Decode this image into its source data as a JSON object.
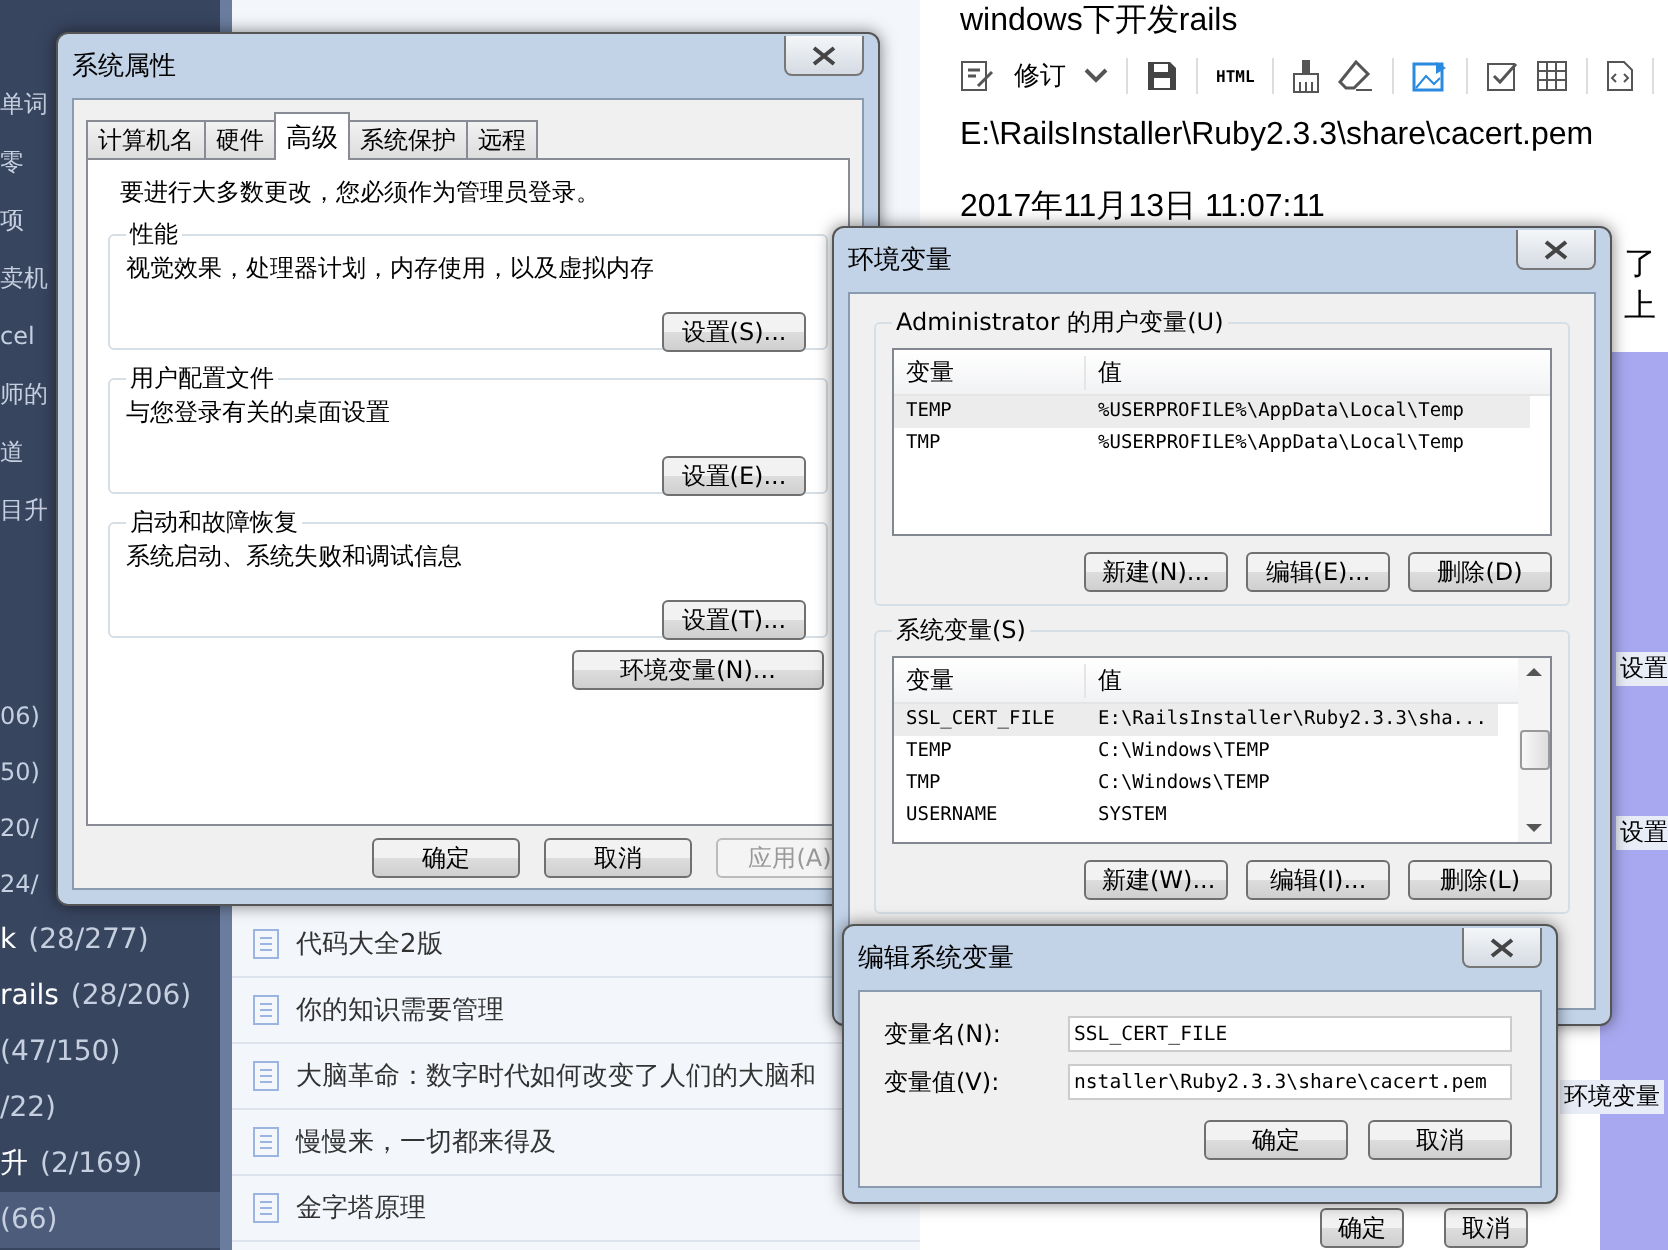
{
  "sidebar": {
    "top_items": [
      {
        "label": "单词"
      },
      {
        "label": "零"
      },
      {
        "label": "项"
      },
      {
        "label": "卖机"
      },
      {
        "label": "cel"
      },
      {
        "label": "师的"
      },
      {
        "label": "道"
      },
      {
        "label": "目升"
      }
    ],
    "count_items": [
      {
        "count": "06)",
        "selected": false
      },
      {
        "count": "50)",
        "selected": false
      },
      {
        "count": "20/",
        "selected": false
      },
      {
        "count": "24/",
        "selected": false
      },
      {
        "label": "k",
        "count": "(28/277)",
        "selected": false
      },
      {
        "label": "rails",
        "count": "(28/206)",
        "selected": false
      },
      {
        "count": "(47/150)",
        "selected": false
      },
      {
        "count": "/22)",
        "selected": false
      },
      {
        "label": "升",
        "count": "(2/169)",
        "selected": false
      },
      {
        "count": "(66)",
        "selected": true
      }
    ]
  },
  "note_list": {
    "items": [
      {
        "title": "代码大全2版"
      },
      {
        "title": "你的知识需要管理"
      },
      {
        "title": "大脑革命：数字时代如何改变了人们的大脑和"
      },
      {
        "title": "慢慢来，一切都来得及"
      },
      {
        "title": "金字塔原理"
      }
    ]
  },
  "editor": {
    "title": "windows下开发rails",
    "toolbar": {
      "revise_label": "修订",
      "html_label": "HTML"
    },
    "lines": [
      "E:\\RailsInstaller\\Ruby2.3.3\\share\\cacert.pem",
      "2017年11月13日 11:07:11"
    ],
    "side_fragment": "了上"
  },
  "background_window": {
    "fragments": [
      "设置",
      "设置",
      "环境变量"
    ],
    "buttons": [
      "确定",
      "取消"
    ]
  },
  "system_properties": {
    "title": "系统属性",
    "tabs": [
      {
        "label": "计算机名",
        "selected": false
      },
      {
        "label": "硬件",
        "selected": false
      },
      {
        "label": "高级",
        "selected": true
      },
      {
        "label": "系统保护",
        "selected": false
      },
      {
        "label": "远程",
        "selected": false
      }
    ],
    "notice": "要进行大多数更改，您必须作为管理员登录。",
    "groups": [
      {
        "title": "性能",
        "description": "视觉效果，处理器计划，内存使用，以及虚拟内存",
        "button": "设置(S)..."
      },
      {
        "title": "用户配置文件",
        "description": "与您登录有关的桌面设置",
        "button": "设置(E)..."
      },
      {
        "title": "启动和故障恢复",
        "description": "系统启动、系统失败和调试信息",
        "button": "设置(T)..."
      }
    ],
    "env_button": "环境变量(N)...",
    "footer_buttons": [
      {
        "label": "确定",
        "disabled": false
      },
      {
        "label": "取消",
        "disabled": false
      },
      {
        "label": "应用(A)",
        "disabled": true
      }
    ]
  },
  "environment_variables": {
    "title": "环境变量",
    "sections": [
      {
        "title": "Administrator 的用户变量(U)",
        "columns": [
          "变量",
          "值"
        ],
        "scrollbar": false,
        "rows": [
          {
            "name": "TEMP",
            "value": "%USERPROFILE%\\AppData\\Local\\Temp",
            "selected": true
          },
          {
            "name": "TMP",
            "value": "%USERPROFILE%\\AppData\\Local\\Temp",
            "selected": false
          }
        ],
        "buttons": [
          "新建(N)...",
          "编辑(E)...",
          "删除(D)"
        ]
      },
      {
        "title": "系统变量(S)",
        "columns": [
          "变量",
          "值"
        ],
        "scrollbar": true,
        "rows": [
          {
            "name": "SSL_CERT_FILE",
            "value": "E:\\RailsInstaller\\Ruby2.3.3\\sha...",
            "selected": true
          },
          {
            "name": "TEMP",
            "value": "C:\\Windows\\TEMP",
            "selected": false
          },
          {
            "name": "TMP",
            "value": "C:\\Windows\\TEMP",
            "selected": false
          },
          {
            "name": "USERNAME",
            "value": "SYSTEM",
            "selected": false
          }
        ],
        "buttons": [
          "新建(W)...",
          "编辑(I)...",
          "删除(L)"
        ]
      }
    ]
  },
  "edit_system_variable": {
    "title": "编辑系统变量",
    "fields": [
      {
        "label": "变量名(N):",
        "value": "SSL_CERT_FILE"
      },
      {
        "label": "变量值(V):",
        "value": "nstaller\\Ruby2.3.3\\share\\cacert.pem"
      }
    ],
    "buttons": [
      "确定",
      "取消"
    ]
  }
}
